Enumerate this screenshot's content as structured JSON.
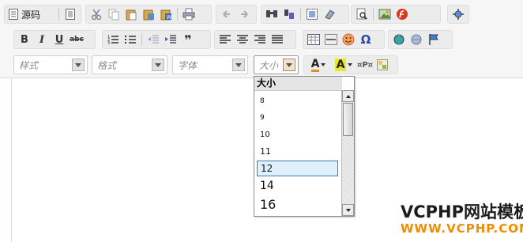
{
  "toolbar": {
    "row1": {
      "source_label": "源码",
      "icons": [
        "source-icon",
        "templates-icon",
        "cut-icon",
        "copy-icon",
        "paste-icon",
        "paste-text-icon",
        "paste-word-icon",
        "print-icon",
        "undo-icon",
        "redo-icon",
        "find-icon",
        "replace-icon",
        "select-all-icon",
        "remove-format-icon",
        "preview-icon",
        "image-icon",
        "flash-icon",
        "maximize-icon"
      ]
    },
    "row2": {
      "bold_label": "B",
      "italic_label": "I",
      "underline_label": "U",
      "strike_label": "abc",
      "quote_label": "❞"
    },
    "row3": {
      "styles_label": "样式",
      "format_label": "格式",
      "font_label": "字体",
      "size_label": "大小",
      "text_color_label": "A",
      "bg_color_label": "A",
      "show_blocks_label": "¶"
    }
  },
  "font_size_dropdown": {
    "header": "大小",
    "items": [
      "8",
      "9",
      "10",
      "11",
      "12",
      "14",
      "16"
    ],
    "selected": "12",
    "scroll_position": 0.0
  },
  "watermark": {
    "line1": "VCPHP网站模板",
    "line2": "WWW.VCPHP.COM"
  },
  "colors": {
    "toolbar_bg": "#f6f6f6",
    "selected_item_bg": "#dff0fb",
    "selected_item_border": "#3b7db5",
    "watermark_orange": "#f08c00"
  }
}
